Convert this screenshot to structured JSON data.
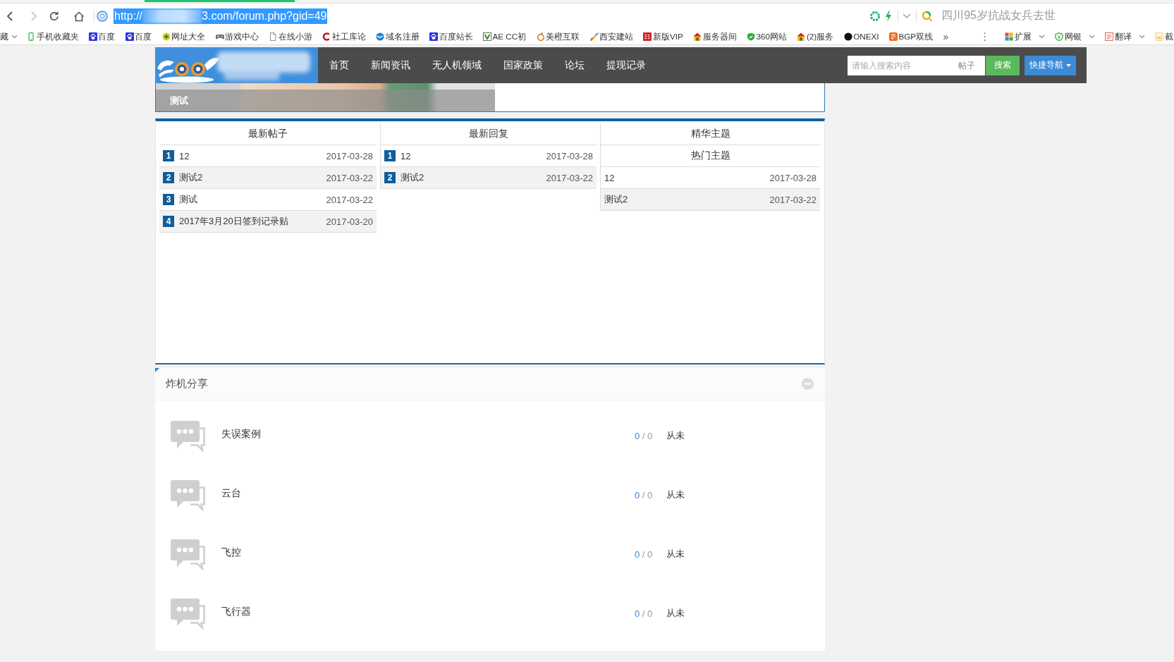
{
  "browser": {
    "nav_buttons": [
      {
        "kind": "back",
        "disabled": false
      },
      {
        "kind": "forward",
        "disabled": true
      },
      {
        "kind": "reload",
        "disabled": false
      },
      {
        "kind": "home",
        "disabled": false
      }
    ],
    "address": {
      "text_before": "http://",
      "text_after": "3.com/forum.php?gid=49",
      "selected": true
    },
    "trending_search": "四川95岁抗战女兵去世",
    "bookmarks": [
      {
        "label": "藏",
        "dropdown": true
      },
      {
        "label": "手机收藏夹",
        "dropdown": false
      },
      {
        "label": "百度",
        "dropdown": false
      },
      {
        "label": "百度",
        "dropdown": false
      },
      {
        "label": "网址大全",
        "dropdown": false
      },
      {
        "label": "游戏中心",
        "dropdown": false
      },
      {
        "label": "在线小游",
        "dropdown": false
      },
      {
        "label": "社工库论",
        "dropdown": false
      },
      {
        "label": "域名注册",
        "dropdown": false
      },
      {
        "label": "百度站长",
        "dropdown": false
      },
      {
        "label": "AE CC初",
        "dropdown": false
      },
      {
        "label": "美橙互联",
        "dropdown": false
      },
      {
        "label": "西安建站",
        "dropdown": false
      },
      {
        "label": "新版VIP",
        "dropdown": false
      },
      {
        "label": "服务器间",
        "dropdown": false
      },
      {
        "label": "360网站",
        "dropdown": false
      },
      {
        "label": "(2)服务",
        "dropdown": false
      },
      {
        "label": "ONEXI",
        "dropdown": false
      },
      {
        "label": "BGP双线",
        "dropdown": false
      }
    ],
    "bookmarks_overflow": "»",
    "menu": "⋮",
    "extensions": [
      {
        "label": "扩展",
        "dropdown": true
      },
      {
        "label": "网银",
        "dropdown": true
      },
      {
        "label": "翻译",
        "dropdown": true
      },
      {
        "label": "截",
        "dropdown": false
      }
    ]
  },
  "site": {
    "nav": [
      {
        "label": "首页",
        "selected": false
      },
      {
        "label": "新闻资讯",
        "selected": false
      },
      {
        "label": "无人机领域",
        "selected": false
      },
      {
        "label": "国家政策",
        "selected": false
      },
      {
        "label": "论坛",
        "selected": false
      },
      {
        "label": "提现记录",
        "selected": false
      }
    ],
    "search": {
      "placeholder": "请输入搜索内容",
      "scope": "帖子",
      "button": "搜索"
    },
    "quick_nav": "快捷导航",
    "banner": {
      "caption": "测试"
    },
    "lists": [
      {
        "heading": "最新帖子",
        "rows": [
          {
            "rank": "1",
            "title": "12",
            "date": "2017-03-28"
          },
          {
            "rank": "2",
            "title": "测试2",
            "date": "2017-03-22"
          },
          {
            "rank": "3",
            "title": "测试",
            "date": "2017-03-22"
          },
          {
            "rank": "4",
            "title": "2017年3月20日签到记录贴",
            "date": "2017-03-20"
          }
        ]
      },
      {
        "heading": "最新回复",
        "rows": [
          {
            "rank": "1",
            "title": "12",
            "date": "2017-03-28"
          },
          {
            "rank": "2",
            "title": "测试2",
            "date": "2017-03-22"
          }
        ]
      },
      {
        "heading": "精华主题",
        "subheading": "热门主题",
        "rows": [
          {
            "title": "12",
            "date": "2017-03-28"
          },
          {
            "title": "测试2",
            "date": "2017-03-22"
          }
        ]
      }
    ],
    "category": {
      "title": "炸机分享",
      "collapsed": false,
      "forums": [
        {
          "name": "失误案例",
          "threads": "0",
          "separator": "/",
          "posts": "0",
          "last_post": "从未"
        },
        {
          "name": "云台",
          "threads": "0",
          "separator": "/",
          "posts": "0",
          "last_post": "从未"
        },
        {
          "name": "飞控",
          "threads": "0",
          "separator": "/",
          "posts": "0",
          "last_post": "从未"
        },
        {
          "name": "飞行器",
          "threads": "0",
          "separator": "/",
          "posts": "0",
          "last_post": "从未"
        }
      ]
    }
  }
}
